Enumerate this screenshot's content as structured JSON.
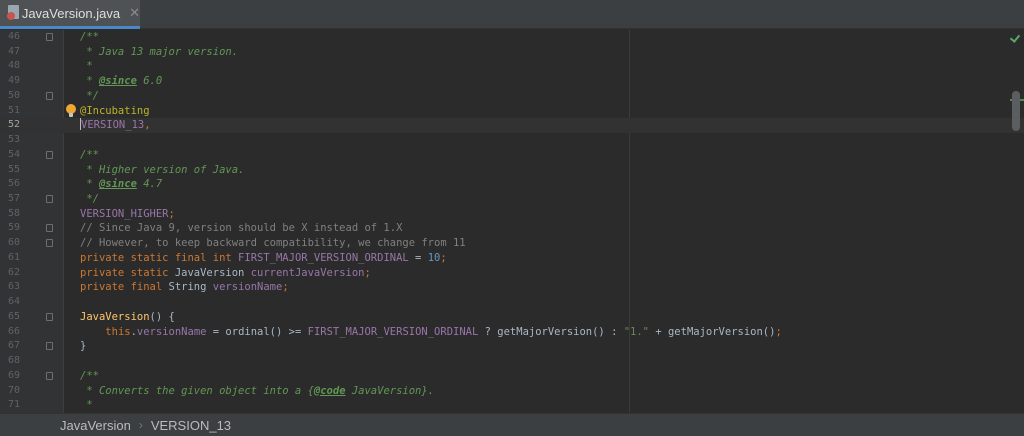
{
  "tab": {
    "label": "JavaVersion.java",
    "close_glyph": "✕",
    "icon": "java-file-icon"
  },
  "editor": {
    "current_line": 52,
    "lines": [
      {
        "n": 46,
        "fold": true,
        "tokens": [
          [
            "doc",
            "/**"
          ]
        ]
      },
      {
        "n": 47,
        "fold": false,
        "tokens": [
          [
            "doc",
            " * Java 13 major version."
          ]
        ]
      },
      {
        "n": 48,
        "fold": false,
        "tokens": [
          [
            "doc",
            " *"
          ]
        ]
      },
      {
        "n": 49,
        "fold": false,
        "tokens": [
          [
            "doc",
            " * "
          ],
          [
            "tag",
            "@since"
          ],
          [
            "doc",
            " 6.0"
          ]
        ]
      },
      {
        "n": 50,
        "fold": true,
        "tokens": [
          [
            "doc",
            " */"
          ]
        ]
      },
      {
        "n": 51,
        "fold": false,
        "tokens": [
          [
            "ann",
            "@Incubating"
          ]
        ]
      },
      {
        "n": 52,
        "fold": false,
        "caret": true,
        "tokens": [
          [
            "field",
            "VERSION_13"
          ],
          [
            "kw",
            ","
          ]
        ]
      },
      {
        "n": 53,
        "fold": false,
        "tokens": []
      },
      {
        "n": 54,
        "fold": true,
        "tokens": [
          [
            "doc",
            "/**"
          ]
        ]
      },
      {
        "n": 55,
        "fold": false,
        "tokens": [
          [
            "doc",
            " * Higher version of Java."
          ]
        ]
      },
      {
        "n": 56,
        "fold": false,
        "tokens": [
          [
            "doc",
            " * "
          ],
          [
            "tag",
            "@since"
          ],
          [
            "doc",
            " 4.7"
          ]
        ]
      },
      {
        "n": 57,
        "fold": true,
        "tokens": [
          [
            "doc",
            " */"
          ]
        ]
      },
      {
        "n": 58,
        "fold": false,
        "tokens": [
          [
            "field",
            "VERSION_HIGHER"
          ],
          [
            "kw",
            ";"
          ]
        ]
      },
      {
        "n": 59,
        "fold": true,
        "tokens": [
          [
            "line",
            "// Since Java 9, version should be X instead of 1.X"
          ]
        ]
      },
      {
        "n": 60,
        "fold": true,
        "tokens": [
          [
            "line",
            "// However, to keep backward compatibility, we change from 11"
          ]
        ]
      },
      {
        "n": 61,
        "fold": false,
        "tokens": [
          [
            "kw",
            "private static final int "
          ],
          [
            "field",
            "FIRST_MAJOR_VERSION_ORDINAL"
          ],
          [
            "plain",
            " = "
          ],
          [
            "num",
            "10"
          ],
          [
            "kw",
            ";"
          ]
        ]
      },
      {
        "n": 62,
        "fold": false,
        "tokens": [
          [
            "kw",
            "private static "
          ],
          [
            "plain",
            "JavaVersion "
          ],
          [
            "field",
            "currentJavaVersion"
          ],
          [
            "kw",
            ";"
          ]
        ]
      },
      {
        "n": 63,
        "fold": false,
        "tokens": [
          [
            "kw",
            "private final "
          ],
          [
            "plain",
            "String "
          ],
          [
            "field",
            "versionName"
          ],
          [
            "kw",
            ";"
          ]
        ]
      },
      {
        "n": 64,
        "fold": false,
        "tokens": []
      },
      {
        "n": 65,
        "fold": true,
        "tokens": [
          [
            "fn",
            "JavaVersion"
          ],
          [
            "plain",
            "() {"
          ]
        ]
      },
      {
        "n": 66,
        "fold": false,
        "tokens": [
          [
            "plain",
            "    "
          ],
          [
            "kw",
            "this"
          ],
          [
            "plain",
            "."
          ],
          [
            "field",
            "versionName"
          ],
          [
            "plain",
            " = ordinal() >= "
          ],
          [
            "field",
            "FIRST_MAJOR_VERSION_ORDINAL"
          ],
          [
            "plain",
            " ? getMajorVersion() : "
          ],
          [
            "str",
            "\"1.\""
          ],
          [
            "plain",
            " + getMajorVersion()"
          ],
          [
            "kw",
            ";"
          ]
        ]
      },
      {
        "n": 67,
        "fold": true,
        "tokens": [
          [
            "plain",
            "}"
          ]
        ]
      },
      {
        "n": 68,
        "fold": false,
        "tokens": []
      },
      {
        "n": 69,
        "fold": true,
        "tokens": [
          [
            "doc",
            "/**"
          ]
        ]
      },
      {
        "n": 70,
        "fold": false,
        "tokens": [
          [
            "doc",
            " * Converts the given object into a {"
          ],
          [
            "tag",
            "@code"
          ],
          [
            "doc",
            " JavaVersion}."
          ]
        ]
      },
      {
        "n": 71,
        "fold": false,
        "tokens": [
          [
            "doc",
            " *"
          ]
        ]
      }
    ]
  },
  "breadcrumb": {
    "items": [
      "JavaVersion",
      "VERSION_13"
    ],
    "separator": "›"
  },
  "colors": {
    "background": "#2b2b2b",
    "keyword": "#cc7832",
    "doc_comment": "#629755",
    "line_comment": "#808080",
    "field": "#9876aa",
    "number": "#6897bb",
    "string": "#6a8759",
    "annotation": "#bbb529",
    "inspection_ok": "#59a869"
  }
}
